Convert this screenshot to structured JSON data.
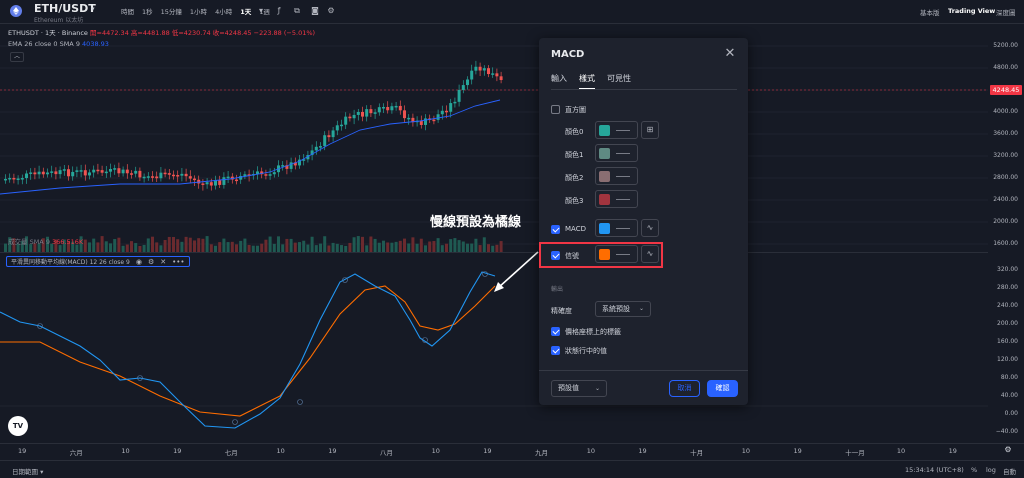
{
  "header": {
    "symbol": "ETH/USDT",
    "caret": "▾",
    "subtitle": "Ethereum 以太坊",
    "timeframes": [
      "時間",
      "1秒",
      "15分鐘",
      "1小時",
      "4小時",
      "1天",
      "1週"
    ],
    "active_timeframe_index": 5,
    "right_links": [
      "基本版",
      "Trading View",
      "深度圖"
    ]
  },
  "legend": {
    "title": "ETHUSDT · 1天 · Binance",
    "open": "開=4472.34",
    "high": "高=4481.88",
    "low": "低=4230.74",
    "close": "收=4248.45",
    "change": "−223.88 (−5.01%)",
    "ema_label": "EMA 26 close 0 SMA 9",
    "ema_value": "4038.93"
  },
  "price_axis": {
    "labels": [
      "5200.00",
      "4800.00",
      "4400.00",
      "4000.00",
      "3600.00",
      "3200.00",
      "2800.00",
      "2400.00",
      "2000.00",
      "1600.00"
    ],
    "current_price": "4248.45"
  },
  "volume": {
    "label": "成交量 SMA 9",
    "value": "366.516K"
  },
  "macd_legend": {
    "label": "平滑異同移動平均線(MACD) 12 26 close 9",
    "more": "•••"
  },
  "macd_axis": {
    "labels": [
      "320.00",
      "280.00",
      "240.00",
      "200.00",
      "160.00",
      "120.00",
      "80.00",
      "40.00",
      "0.00",
      "−40.00"
    ]
  },
  "time_axis": {
    "labels": [
      "19",
      "六月",
      "10",
      "19",
      "七月",
      "10",
      "19",
      "八月",
      "10",
      "19",
      "九月",
      "10",
      "19",
      "十月",
      "10",
      "19",
      "十一月",
      "10",
      "19"
    ]
  },
  "bottom_bar": {
    "range": "日期範圍",
    "caret": "▾",
    "clock": "15:34:14 (UTC+8)",
    "percent": "%",
    "log": "log",
    "auto": "自動"
  },
  "annotation": "慢線預設為橘線",
  "dialog": {
    "title": "MACD",
    "close": "✕",
    "tabs": [
      "輸入",
      "樣式",
      "可見性"
    ],
    "active_tab_index": 1,
    "histogram": {
      "label": "直方圖",
      "checked": false
    },
    "color_rows": [
      {
        "label": "顏色0",
        "color": "#26a69a"
      },
      {
        "label": "顏色1",
        "color": "#5f8a83"
      },
      {
        "label": "顏色2",
        "color": "#8a6e72"
      },
      {
        "label": "顏色3",
        "color": "#a2343e"
      }
    ],
    "macd_row": {
      "label": "MACD",
      "checked": true,
      "color": "#2196f3"
    },
    "signal_row": {
      "label": "信號",
      "checked": true,
      "color": "#ff6d00"
    },
    "output_header": "輸出",
    "precision": {
      "label": "精確度",
      "value": "系統預設"
    },
    "price_label_check": {
      "label": "價格座標上的標籤",
      "checked": true
    },
    "status_line_check": {
      "label": "狀態行中的值",
      "checked": true
    },
    "defaults": "預設值",
    "cancel": "取消",
    "ok": "確認"
  },
  "colors": {
    "background": "#161a25",
    "up": "#26a69a",
    "down": "#ef5350",
    "ema": "#2962ff",
    "macd": "#2196f3",
    "signal": "#ff6d00",
    "highlight": "#f23645",
    "accent": "#2962ff"
  }
}
